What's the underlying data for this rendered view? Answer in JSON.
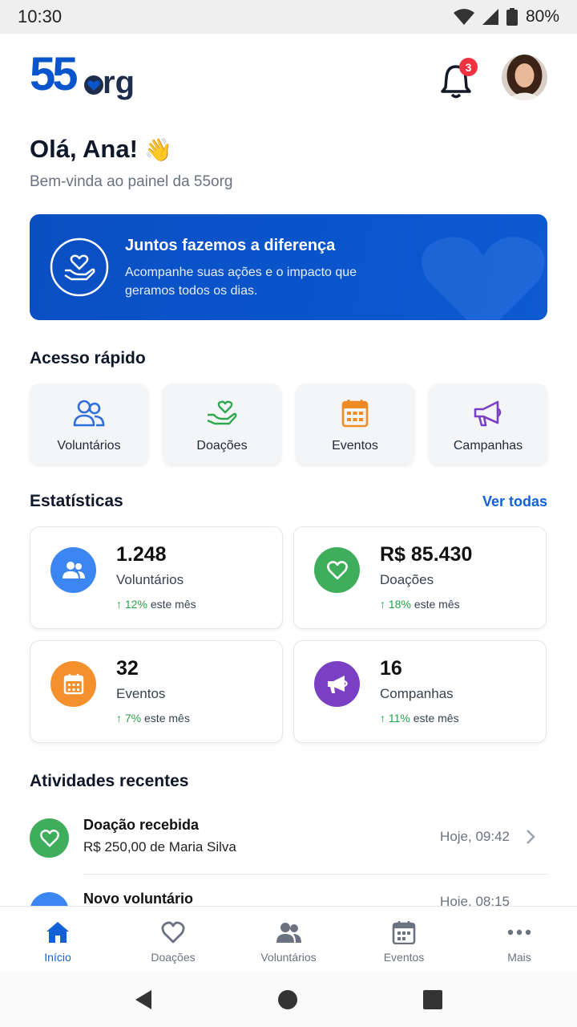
{
  "status": {
    "time": "10:30",
    "battery": "80%"
  },
  "header": {
    "logo_text": "55org",
    "notifications_count": "3",
    "icons": {
      "bell": "bell-icon",
      "avatar": "user-avatar"
    }
  },
  "greeting": {
    "title": "Olá, Ana!",
    "emoji": "👋",
    "subtitle": "Bem-vinda ao painel da 55org"
  },
  "banner": {
    "title": "Juntos fazemos a diferença",
    "text": "Acompanhe suas ações e o impacto que geramos todos os dias.",
    "icon": "heart-hand-icon",
    "color": "#0a55cc"
  },
  "quick_access": {
    "title": "Acesso rápido",
    "items": [
      {
        "label": "Voluntários",
        "icon": "users-icon",
        "color": "#2f6fdc"
      },
      {
        "label": "Doações",
        "icon": "heart-hand-icon",
        "color": "#2fa84f"
      },
      {
        "label": "Eventos",
        "icon": "calendar-icon",
        "color": "#f08a24"
      },
      {
        "label": "Campanhas",
        "icon": "megaphone-icon",
        "color": "#7b3fc4"
      }
    ]
  },
  "stats": {
    "title": "Estatísticas",
    "see_all": "Ver todas",
    "cards": [
      {
        "value": "1.248",
        "label": "Voluntários",
        "delta": "12%",
        "delta_suffix": "este mês",
        "icon": "users-icon",
        "color": "#3b86f0"
      },
      {
        "value": "R$ 85.430",
        "label": "Doações",
        "delta": "18%",
        "delta_suffix": "este mês",
        "icon": "heart-icon",
        "color": "#3fae5c"
      },
      {
        "value": "32",
        "label": "Eventos",
        "delta": "7%",
        "delta_suffix": "este mês",
        "icon": "calendar-icon",
        "color": "#f5912c"
      },
      {
        "value": "16",
        "label": "Companhas",
        "delta": "11%",
        "delta_suffix": "este mês",
        "icon": "megaphone-icon",
        "color": "#7a3fc2"
      }
    ]
  },
  "activities": {
    "title": "Atividades recentes",
    "items": [
      {
        "title": "Doação recebida",
        "subtitle": "R$ 250,00 de Maria Silva",
        "time": "Hoje, 09:42",
        "icon": "heart-icon",
        "color": "#3fae5c"
      },
      {
        "title": "Novo voluntário",
        "subtitle": "",
        "time": "Hoje, 08:15",
        "icon": "user-icon",
        "color": "#3b86f0"
      }
    ]
  },
  "bottom_nav": {
    "items": [
      {
        "label": "Início",
        "icon": "home-icon",
        "active": true
      },
      {
        "label": "Doações",
        "icon": "heart-icon",
        "active": false
      },
      {
        "label": "Voluntários",
        "icon": "users-icon",
        "active": false
      },
      {
        "label": "Eventos",
        "icon": "calendar-icon",
        "active": false
      },
      {
        "label": "Mais",
        "icon": "more-icon",
        "active": false
      }
    ],
    "active_color": "#1261d6"
  }
}
